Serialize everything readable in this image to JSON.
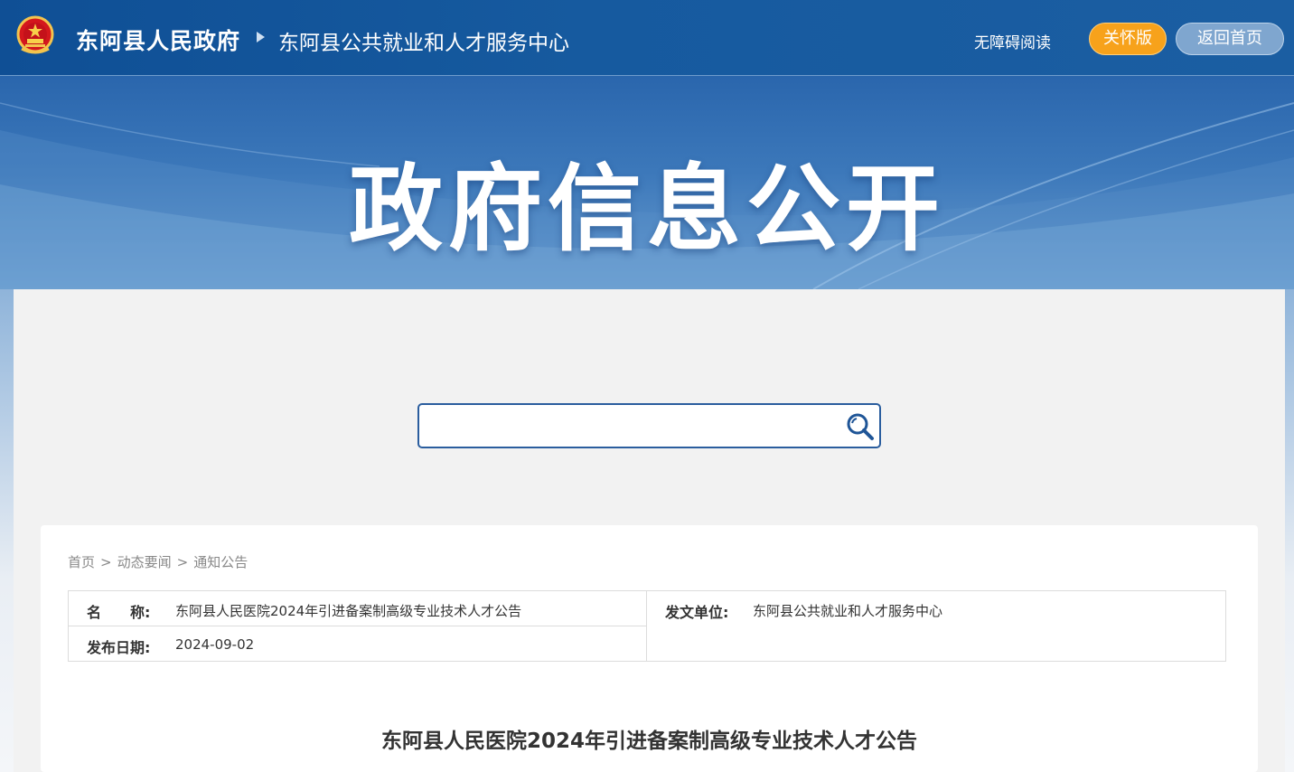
{
  "header": {
    "gov_name": "东阿县人民政府",
    "center_name": "东阿县公共就业和人才服务中心",
    "accessibility_label": "无障碍阅读",
    "care_label": "关怀版",
    "home_label": "返回首页"
  },
  "banner": {
    "title": "政府信息公开"
  },
  "search": {
    "placeholder": "",
    "value": ""
  },
  "breadcrumb": {
    "items": [
      "首页",
      "动态要闻",
      "通知公告"
    ],
    "separator": ">"
  },
  "meta": {
    "name_label": "名　　称:",
    "name_value": "东阿县人民医院2024年引进备案制高级专业技术人才公告",
    "date_label": "发布日期:",
    "date_value": "2024-09-02",
    "issuer_label": "发文单位:",
    "issuer_value": "东阿县公共就业和人才服务中心"
  },
  "article": {
    "title": "东阿县人民医院2024年引进备案制高级专业技术人才公告"
  },
  "colors": {
    "header_bg": "#165a9f",
    "care_button": "#f7a21b",
    "home_button": "#7fa6cf",
    "search_border": "#2a5d9e"
  },
  "icons": {
    "emblem": "national-emblem-icon",
    "arrow": "triangle-right-icon",
    "search": "magnifier-icon"
  }
}
